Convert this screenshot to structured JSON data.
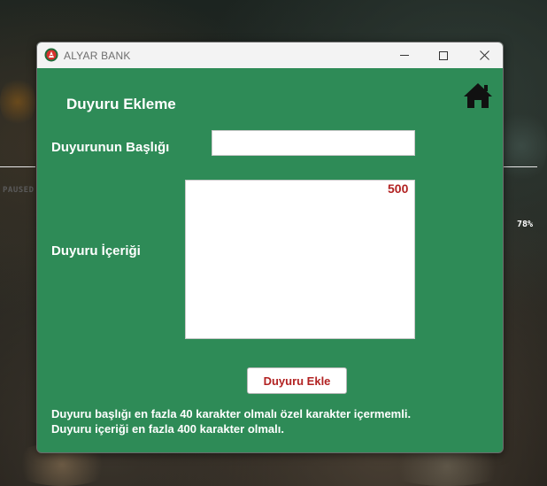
{
  "background": {
    "paused_text": "PAUSED",
    "percent_text": "78%"
  },
  "window": {
    "title": "ALYAR BANK",
    "accent_color": "#2e8b57"
  },
  "form": {
    "heading": "Duyuru Ekleme",
    "title_label": "Duyurunun Başlığı",
    "title_value": "",
    "content_label": "Duyuru İçeriği",
    "content_value": "",
    "char_remaining": "500",
    "submit_label": "Duyuru Ekle"
  },
  "notes": {
    "line1": "Duyuru başlığı en fazla 40 karakter olmalı özel karakter içermemli.",
    "line2": "Duyuru içeriği en fazla 400 karakter olmalı."
  },
  "icons": {
    "home": "home-icon",
    "app": "bank-logo-icon"
  }
}
